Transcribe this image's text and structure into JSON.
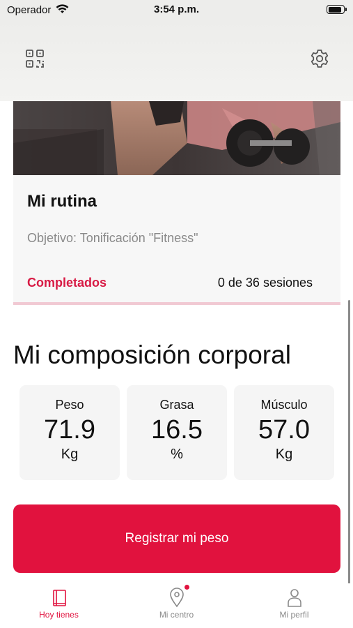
{
  "status_bar": {
    "carrier": "Operador",
    "time": "3:54 p.m.",
    "battery_level": 0.9
  },
  "top_bar": {
    "left_icon": "qr-code-icon",
    "right_icon": "gear-icon"
  },
  "routine_card": {
    "title": "Mi rutina",
    "goal": "Objetivo: Tonificación \"Fitness\"",
    "completed_label": "Completados",
    "sessions": "0 de 36 sesiones"
  },
  "body_composition": {
    "title": "Mi composición corporal",
    "stats": [
      {
        "label": "Peso",
        "value": "71.9",
        "unit": "Kg"
      },
      {
        "label": "Grasa",
        "value": "16.5",
        "unit": "%"
      },
      {
        "label": "Músculo",
        "value": "57.0",
        "unit": "Kg"
      }
    ]
  },
  "register_button": {
    "label": "Registrar mi peso"
  },
  "tabs": [
    {
      "label": "Hoy tienes",
      "icon": "book-icon",
      "active": true
    },
    {
      "label": "Mi centro",
      "icon": "location-pin-icon",
      "active": false,
      "has_notification": true
    },
    {
      "label": "Mi perfil",
      "icon": "person-icon",
      "active": false
    }
  ],
  "colors": {
    "accent": "#e1123e",
    "completed_text": "#d81b45",
    "muted_text": "#8a8a8a",
    "card_bg": "#f7f7f7"
  }
}
